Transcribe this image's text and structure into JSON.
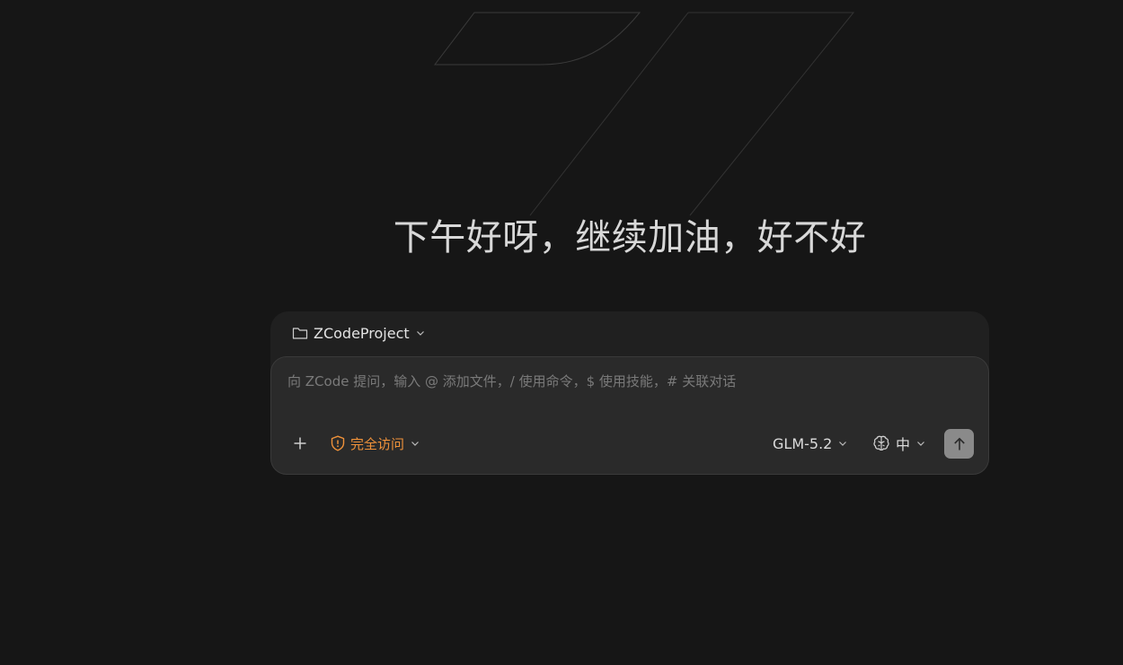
{
  "greeting": "下午好呀，继续加油，好不好",
  "project": {
    "name": "ZCodeProject",
    "icon": "folder-icon"
  },
  "prompt": {
    "placeholder": "向 ZCode 提问，输入 @ 添加文件，/ 使用命令，$ 使用技能，# 关联对话",
    "value": ""
  },
  "toolbar": {
    "access_label": "完全访问",
    "model_label": "GLM-5.2",
    "thinking_label": "中"
  },
  "colors": {
    "background": "#161616",
    "accent_orange": "#f0923a",
    "send_button": "#8a8a8a"
  }
}
